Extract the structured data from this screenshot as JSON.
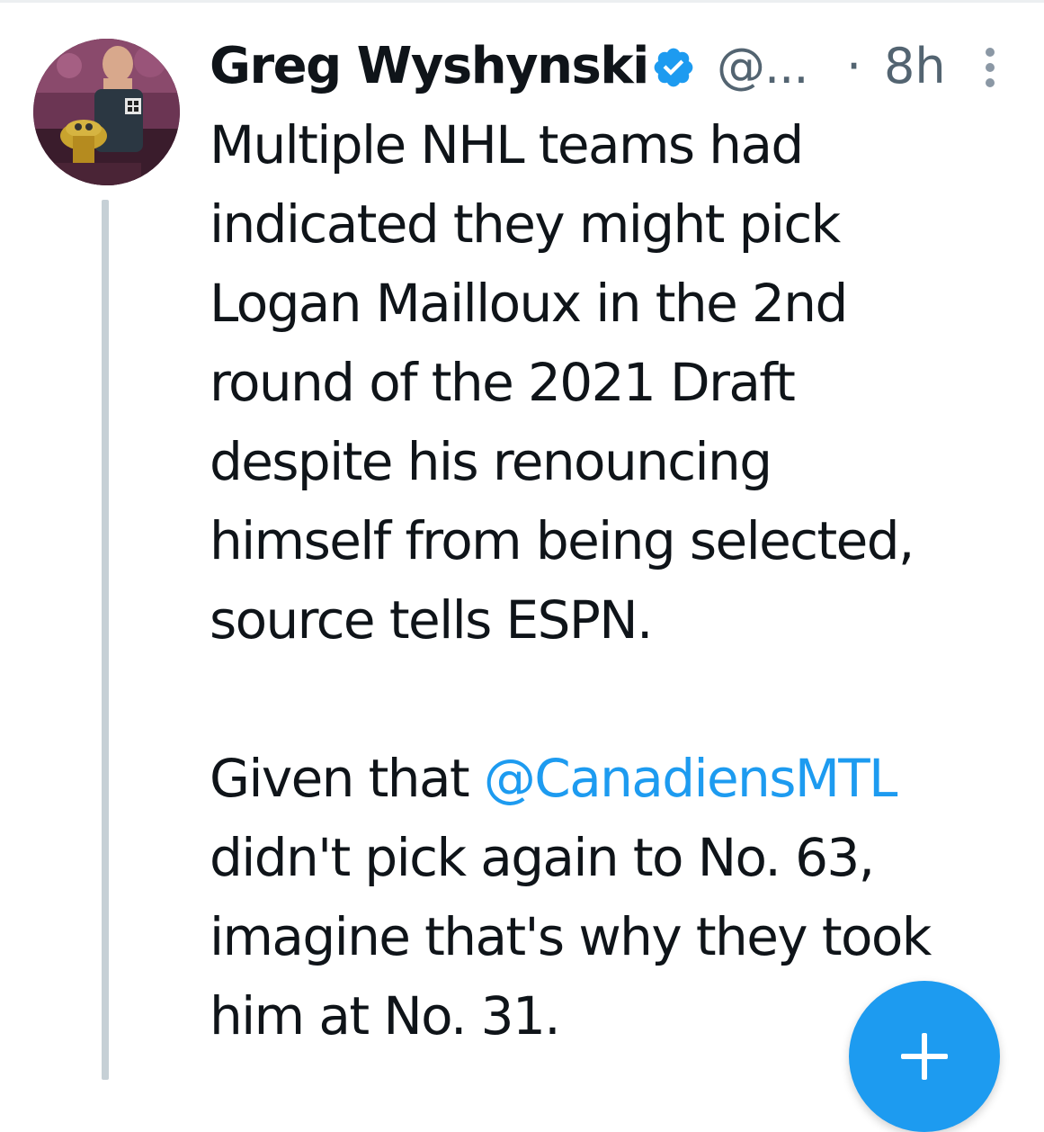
{
  "tweet": {
    "author": {
      "display_name": "Greg Wyshynski",
      "handle": "@...",
      "verified": true
    },
    "separator": "·",
    "timestamp": "8h",
    "body": {
      "paragraph1": [
        "Multiple NHL teams had",
        "indicated they might pick",
        "Logan Mailloux in the 2nd",
        "round of the 2021 Draft",
        "despite his renouncing",
        "himself from being selected,",
        "source tells ESPN."
      ],
      "paragraph2": {
        "line1_prefix": "Given that ",
        "line1_mention": "@CanadiensMTL",
        "lines": [
          "didn't pick again to No. 63,",
          "imagine that's why they took",
          "him at No. 31."
        ]
      }
    }
  },
  "icons": {
    "verified": "verified-badge-icon",
    "more": "more-vertical-icon",
    "compose": "plus-icon"
  },
  "colors": {
    "accent": "#1d9bf0",
    "text": "#0f1419",
    "secondary_text": "#536471",
    "thread_line": "#c6d0d6"
  }
}
